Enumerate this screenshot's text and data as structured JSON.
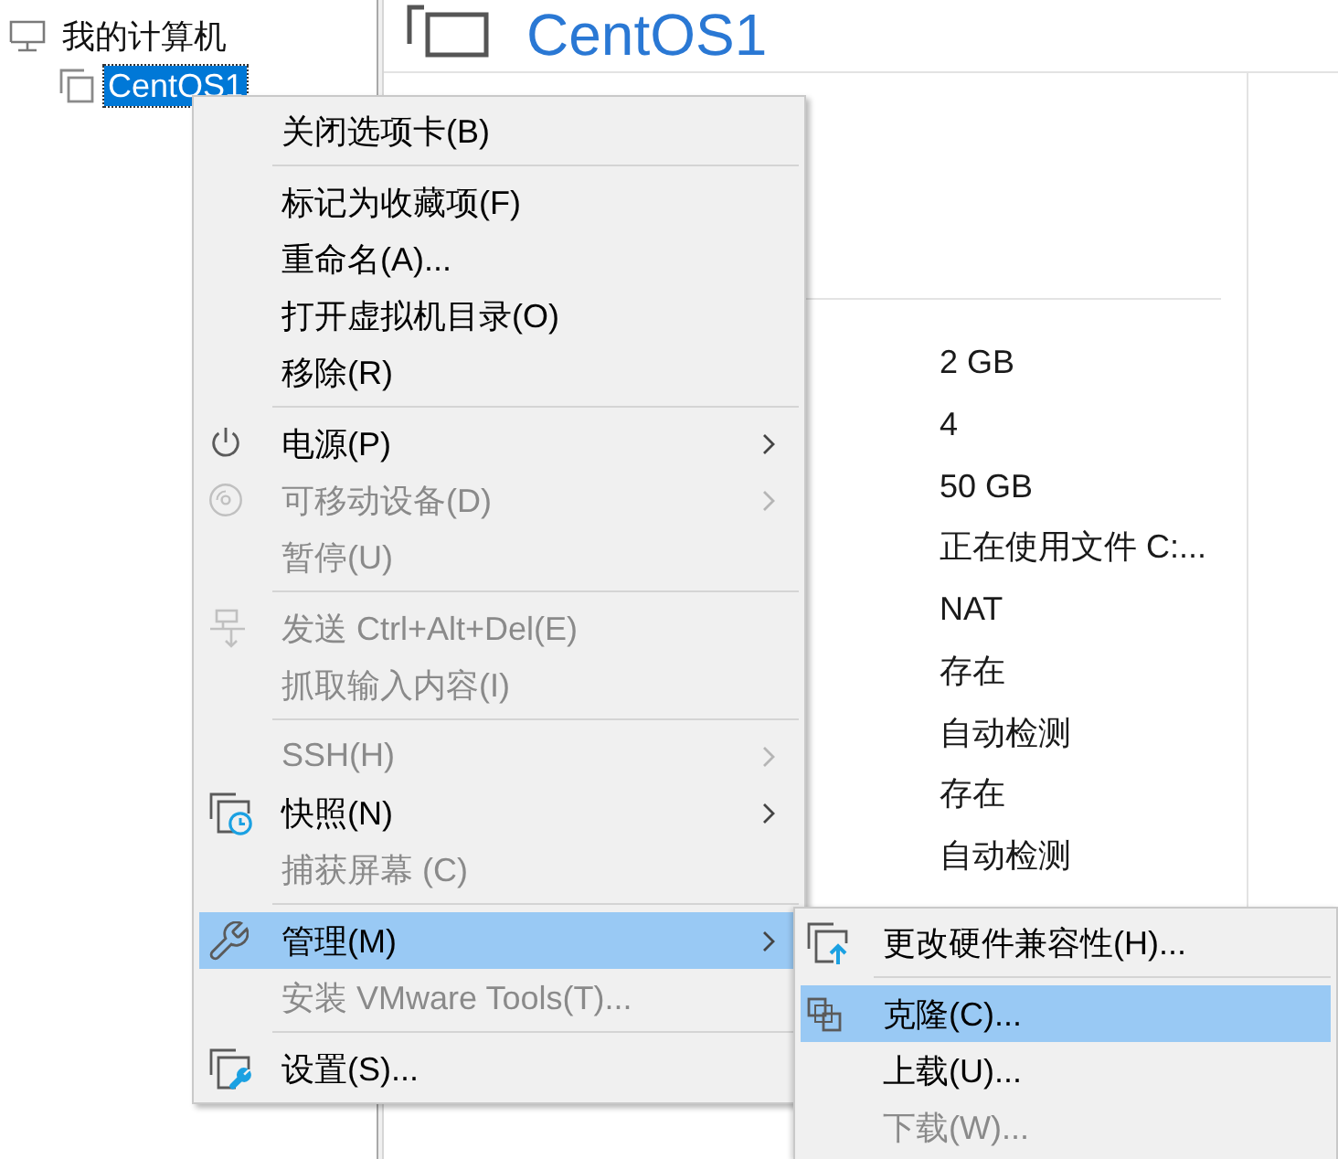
{
  "library": {
    "items": [
      {
        "label": "我的计算机",
        "selected": false,
        "children": [
          {
            "label": "CentOS1",
            "selected": true
          }
        ]
      }
    ]
  },
  "vm_header": {
    "title": "CentOS1"
  },
  "hardware_values": [
    "2 GB",
    "4",
    "50 GB",
    "正在使用文件 C:...",
    "NAT",
    "存在",
    "自动检测",
    "存在",
    "自动检测"
  ],
  "context_menu": {
    "items": [
      {
        "kind": "item",
        "label": "关闭选项卡(B)",
        "disabled": false,
        "selected": false,
        "has_submenu": false
      },
      {
        "kind": "separator"
      },
      {
        "kind": "item",
        "label": "标记为收藏项(F)",
        "disabled": false,
        "selected": false,
        "has_submenu": false
      },
      {
        "kind": "item",
        "label": "重命名(A)...",
        "disabled": false,
        "selected": false,
        "has_submenu": false
      },
      {
        "kind": "item",
        "label": "打开虚拟机目录(O)",
        "disabled": false,
        "selected": false,
        "has_submenu": false
      },
      {
        "kind": "item",
        "label": "移除(R)",
        "disabled": false,
        "selected": false,
        "has_submenu": false
      },
      {
        "kind": "separator"
      },
      {
        "kind": "item",
        "label": "电源(P)",
        "disabled": false,
        "selected": false,
        "has_submenu": true
      },
      {
        "kind": "item",
        "label": "可移动设备(D)",
        "disabled": true,
        "selected": false,
        "has_submenu": true
      },
      {
        "kind": "item",
        "label": "暂停(U)",
        "disabled": true,
        "selected": false,
        "has_submenu": false
      },
      {
        "kind": "separator"
      },
      {
        "kind": "item",
        "label": "发送 Ctrl+Alt+Del(E)",
        "disabled": true,
        "selected": false,
        "has_submenu": false
      },
      {
        "kind": "item",
        "label": "抓取输入内容(I)",
        "disabled": true,
        "selected": false,
        "has_submenu": false
      },
      {
        "kind": "separator"
      },
      {
        "kind": "item",
        "label": "SSH(H)",
        "disabled": true,
        "selected": false,
        "has_submenu": true
      },
      {
        "kind": "item",
        "label": "快照(N)",
        "disabled": false,
        "selected": false,
        "has_submenu": true
      },
      {
        "kind": "item",
        "label": "捕获屏幕 (C)",
        "disabled": true,
        "selected": false,
        "has_submenu": false
      },
      {
        "kind": "separator"
      },
      {
        "kind": "item",
        "label": "管理(M)",
        "disabled": false,
        "selected": true,
        "has_submenu": true
      },
      {
        "kind": "item",
        "label": "安装 VMware Tools(T)...",
        "disabled": true,
        "selected": false,
        "has_submenu": false
      },
      {
        "kind": "separator"
      },
      {
        "kind": "item",
        "label": "设置(S)...",
        "disabled": false,
        "selected": false,
        "has_submenu": false
      }
    ],
    "submenu": {
      "items": [
        {
          "kind": "item",
          "label": "更改硬件兼容性(H)...",
          "disabled": false,
          "selected": false,
          "has_submenu": false
        },
        {
          "kind": "separator"
        },
        {
          "kind": "item",
          "label": "克隆(C)...",
          "disabled": false,
          "selected": true,
          "has_submenu": false
        },
        {
          "kind": "item",
          "label": "上载(U)...",
          "disabled": false,
          "selected": false,
          "has_submenu": false
        },
        {
          "kind": "item",
          "label": "下载(W)...",
          "disabled": true,
          "selected": false,
          "has_submenu": false
        }
      ]
    }
  }
}
